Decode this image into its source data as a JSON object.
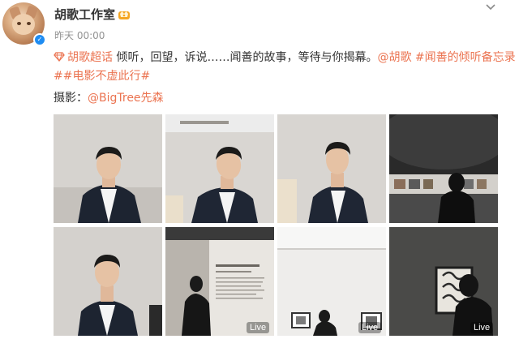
{
  "post": {
    "author": "胡歌工作室",
    "time": "昨天 00:00",
    "text": {
      "super_topic": "胡歌超话",
      "body": " 倾听，回望，诉说……闻善的故事，等待与你揭幕。",
      "mention": "@胡歌",
      "hashtag1": " #闻善的倾听备忘录#",
      "hashtag2": "#电影不虚此行#"
    },
    "credit": {
      "label": "摄影：",
      "mention": "@BigTree先森"
    },
    "live_badges": [
      "Live",
      "Live",
      "Live"
    ]
  },
  "colors": {
    "link": "#eb7350",
    "verified": "#1e8cf2",
    "name": "#333333",
    "time": "#939393"
  },
  "icons": [
    "verified-icon",
    "vip-crown-icon",
    "chevron-down-icon",
    "super-topic-diamond-icon"
  ]
}
